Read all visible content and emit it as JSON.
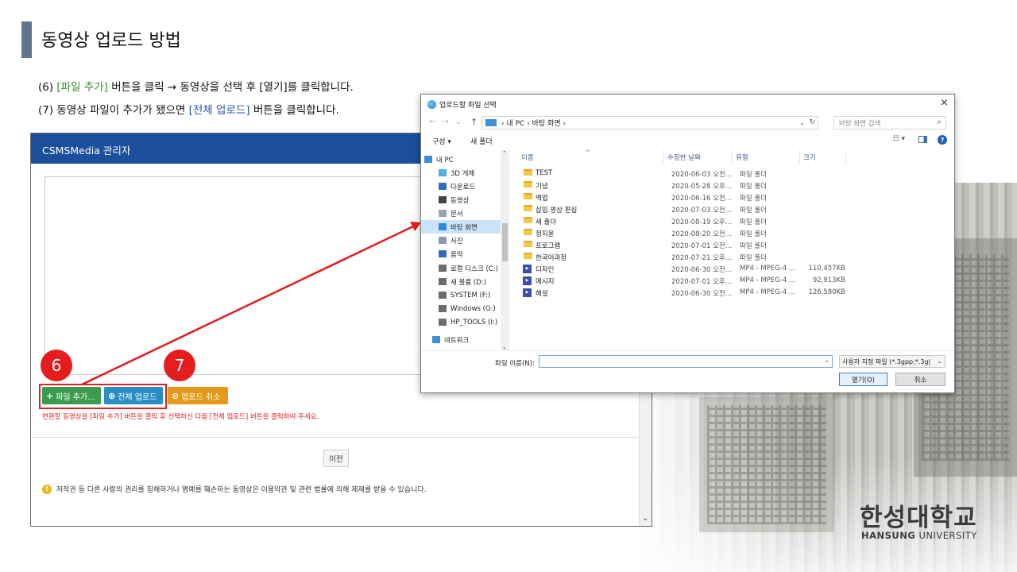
{
  "slide": {
    "title": "동영상 업로드 방법",
    "instruction1": {
      "prefix": "(6) ",
      "highlight": "[파일 추가]",
      "suffix": " 버튼을 클릭 → 동영상을 선택 후 [열기]를 클릭합니다."
    },
    "instruction2": {
      "prefix": "(7) 동영상 파일이 추가가 됐으면 ",
      "highlight": "[전체 업로드]",
      "suffix": " 버튼을 클릭합니다."
    },
    "step_markers": [
      "6",
      "7"
    ],
    "logo": {
      "korean": "한성대학교",
      "english_bold": "HANSUNG",
      "english_rest": " UNIVERSITY"
    },
    "colors": {
      "accent_bar": "#5f7590",
      "header_blue": "#1b4f9c",
      "highlight_red": "#d92222"
    }
  },
  "admin": {
    "title": "CSMSMedia 관리자",
    "buttons": {
      "add_file": "파일 추가...",
      "upload_all": "전체 업로드",
      "cancel_upload": "업로드 취소"
    },
    "button_icons": {
      "add_file": "plus-icon",
      "upload_all": "upload-circle-icon",
      "cancel_upload": "ban-icon"
    },
    "warning_text": "변환할 동영상을 [파일 추가] 버튼을 클릭 후 선택하신 다음 [전체 업로드] 버튼을 클릭하여 주세요.",
    "prev_button": "이전",
    "notice": "저작권 등 다른 사람의 권리를 침해하거나 명예를 훼손하는 동영상은 이용약관 및 관련 법률에 의해 제재를 받을 수 있습니다."
  },
  "dialog": {
    "title": "업로드할 파일 선택",
    "close": "×",
    "breadcrumb": "› 내 PC › 바탕 화면 ›",
    "search_placeholder": "바탕 화면 검색",
    "toolbar": {
      "organize": "구성 ▾",
      "new_folder": "새 폴더"
    },
    "nav_items": [
      {
        "label": "내 PC",
        "icon": "computer-icon"
      },
      {
        "label": "3D 개체",
        "icon": "cube-icon"
      },
      {
        "label": "다운로드",
        "icon": "download-icon"
      },
      {
        "label": "동영상",
        "icon": "video-icon"
      },
      {
        "label": "문서",
        "icon": "document-icon"
      },
      {
        "label": "바탕 화면",
        "icon": "desktop-icon",
        "selected": true
      },
      {
        "label": "사진",
        "icon": "picture-icon"
      },
      {
        "label": "음악",
        "icon": "music-icon"
      },
      {
        "label": "로컬 디스크 (C:)",
        "icon": "drive-icon"
      },
      {
        "label": "새 볼륨 (D:)",
        "icon": "drive-icon"
      },
      {
        "label": "SYSTEM   (F:)",
        "icon": "drive-icon"
      },
      {
        "label": "Windows  (G:)",
        "icon": "drive-icon"
      },
      {
        "label": "HP_TOOLS (I:)",
        "icon": "drive-icon"
      },
      {
        "label": "네트워크",
        "icon": "network-icon"
      }
    ],
    "columns": [
      "이름",
      "수정한 날짜",
      "유형",
      "크기"
    ],
    "files": [
      {
        "name": "TEST",
        "date": "2020-06-03 오전...",
        "type": "파일 폴더",
        "size": "",
        "kind": "folder"
      },
      {
        "name": "기념",
        "date": "2020-05-28 오후...",
        "type": "파일 폴더",
        "size": "",
        "kind": "folder"
      },
      {
        "name": "백업",
        "date": "2020-06-16 오전...",
        "type": "파일 폴더",
        "size": "",
        "kind": "folder"
      },
      {
        "name": "삽입 영상 편집",
        "date": "2020-07-03 오전...",
        "type": "파일 폴더",
        "size": "",
        "kind": "folder"
      },
      {
        "name": "새 폴더",
        "date": "2020-08-19 오후...",
        "type": "파일 폴더",
        "size": "",
        "kind": "folder"
      },
      {
        "name": "정지윤",
        "date": "2020-08-20 오전...",
        "type": "파일 폴더",
        "size": "",
        "kind": "folder"
      },
      {
        "name": "프로그램",
        "date": "2020-07-01 오전...",
        "type": "파일 폴더",
        "size": "",
        "kind": "folder"
      },
      {
        "name": "한국어과정",
        "date": "2020-07-21 오후...",
        "type": "파일 폴더",
        "size": "",
        "kind": "folder"
      },
      {
        "name": "디자인",
        "date": "2020-06-30 오전...",
        "type": "MP4 - MPEG-4 ...",
        "size": "110,457KB",
        "kind": "mp4"
      },
      {
        "name": "메시지",
        "date": "2020-07-01 오후...",
        "type": "MP4 - MPEG-4 ...",
        "size": "92,913KB",
        "kind": "mp4"
      },
      {
        "name": "해설",
        "date": "2020-06-30 오전...",
        "type": "MP4 - MPEG-4 ...",
        "size": "126,580KB",
        "kind": "mp4"
      }
    ],
    "filename_label": "파일 이름(N):",
    "filename_value": "",
    "filetype": "사용자 지정 파일 (*.3gpp;*.3g|",
    "open_button": "열기(O)",
    "cancel_button": "취소"
  }
}
